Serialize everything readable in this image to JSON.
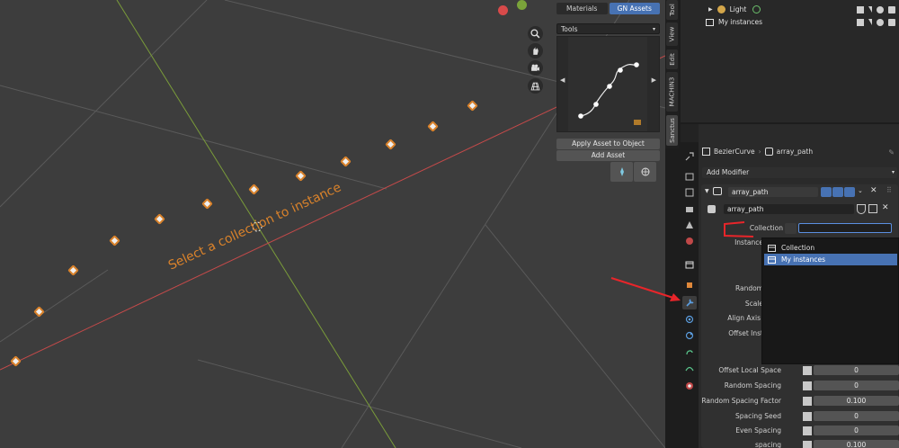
{
  "viewport": {
    "overlay_text": "Select a collection to instance",
    "gizmo_colors": {
      "x": "#d84a4a",
      "y": "#7aa33a",
      "z": "#4a78c8"
    }
  },
  "npanel": {
    "tabs": [
      {
        "label": "Materials"
      },
      {
        "label": "GN Assets",
        "active": true
      }
    ],
    "dropdown_label": "Tools",
    "apply_button": "Apply Asset to Object",
    "add_button": "Add Asset"
  },
  "vertical_tabs": [
    {
      "label": "Tool"
    },
    {
      "label": "View"
    },
    {
      "label": "Edit"
    },
    {
      "label": "MACHIN3"
    },
    {
      "label": "Sanctus",
      "active": true
    }
  ],
  "outliner": {
    "rows": [
      {
        "label": "Light"
      },
      {
        "label": "My instances"
      }
    ]
  },
  "properties": {
    "object_name": "BezierCurve",
    "modifier_name": "array_path",
    "add_modifier": "Add Modifier",
    "modifier_label": "array_path",
    "node_group": "array_path",
    "collection_label": "Collection",
    "rows": [
      {
        "label": "Instance"
      },
      {
        "label": "Random"
      },
      {
        "label": "Scale"
      },
      {
        "label": "Align Axis"
      },
      {
        "label": "Offset Inst"
      },
      {
        "label": "Offset Local Space",
        "value": "0"
      },
      {
        "label": "Random Spacing",
        "value": "0"
      },
      {
        "label": "Random Spacing Factor",
        "value": "0.100"
      },
      {
        "label": "Spacing Seed",
        "value": "0"
      },
      {
        "label": "Even Spacing",
        "value": "0"
      },
      {
        "label": "spacing",
        "value": "0.100"
      }
    ]
  },
  "menu": {
    "items": [
      {
        "label": "Collection"
      },
      {
        "label": "My instances",
        "selected": true
      }
    ]
  },
  "accent_color": "#4772b3",
  "annotation_color": "#e8252a"
}
